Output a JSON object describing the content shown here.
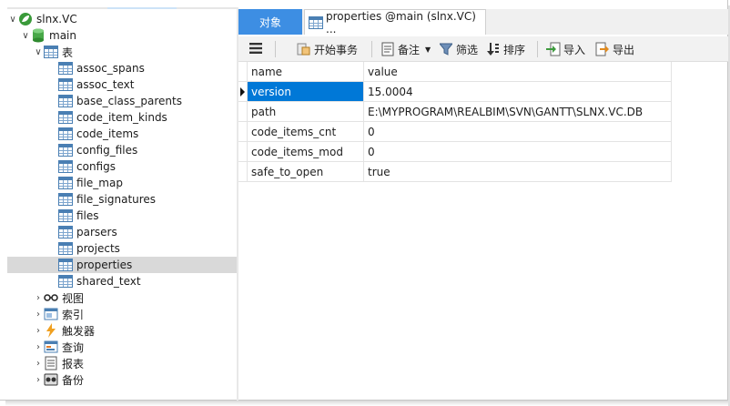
{
  "tree": {
    "root": {
      "label": "slnx.VC",
      "icon": "leaf-db-icon"
    },
    "db": {
      "label": "main",
      "icon": "database-icon"
    },
    "tables_group": {
      "label": "表",
      "icon": "table-icon"
    },
    "tables": [
      "assoc_spans",
      "assoc_text",
      "base_class_parents",
      "code_item_kinds",
      "code_items",
      "config_files",
      "configs",
      "file_map",
      "file_signatures",
      "files",
      "parsers",
      "projects",
      "properties",
      "shared_text"
    ],
    "selected_table": "properties",
    "other_groups": [
      {
        "label": "视图",
        "icon": "glasses-icon"
      },
      {
        "label": "索引",
        "icon": "index-icon"
      },
      {
        "label": "触发器",
        "icon": "lightning-icon"
      },
      {
        "label": "查询",
        "icon": "query-icon"
      },
      {
        "label": "报表",
        "icon": "report-icon"
      },
      {
        "label": "备份",
        "icon": "backup-icon"
      }
    ]
  },
  "tabs": {
    "objects": "对象",
    "properties": "properties @main (slnx.VC) ..."
  },
  "toolbar": {
    "begin_transaction": "开始事务",
    "note": "备注",
    "filter": "筛选",
    "sort": "排序",
    "import": "导入",
    "export": "导出"
  },
  "grid": {
    "headers": {
      "name": "name",
      "value": "value"
    },
    "rows": [
      {
        "name": "version",
        "value": "15.0004",
        "selected": true
      },
      {
        "name": "path",
        "value": "E:\\MYPROGRAM\\REALBIM\\SVN\\GANTT\\SLNX.VC.DB"
      },
      {
        "name": "code_items_cnt",
        "value": "0"
      },
      {
        "name": "code_items_mod",
        "value": "0"
      },
      {
        "name": "safe_to_open",
        "value": "true"
      }
    ]
  },
  "colors": {
    "accent": "#3d8ee3",
    "selection": "#0078d7",
    "tree_selection": "#d9d9d9"
  }
}
